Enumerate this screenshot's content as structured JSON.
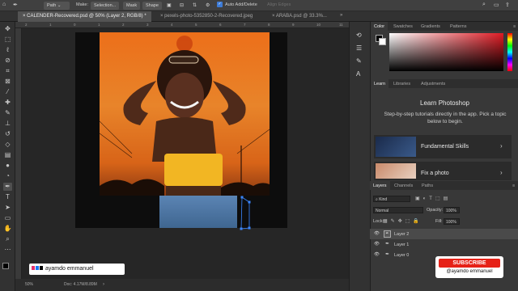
{
  "options_bar": {
    "mode_value": "Path",
    "make_label": "Make:",
    "selection_button": "Selection...",
    "mask_button": "Mask",
    "shape_button": "Shape",
    "auto_add_delete_label": "Auto Add/Delete",
    "align_edges_label": "Align Edges"
  },
  "tabs": [
    {
      "label": "CALENDER-Recovered.psd @ 50% (Layer 2, RGB/8) *",
      "active": true
    },
    {
      "label": "pexels-photo-5352850-2-Recovered.jpeg",
      "active": false
    },
    {
      "label": "ARABA.psd @ 33.3%...",
      "active": false
    }
  ],
  "ruler": {
    "ticks": [
      "2",
      "1",
      "0",
      "1",
      "2",
      "3",
      "4",
      "5",
      "6",
      "7",
      "8",
      "9",
      "10",
      "11"
    ]
  },
  "status": {
    "zoom": "50%",
    "doc": "Doc: 4.17M/8.89M"
  },
  "color_panel": {
    "tabs": [
      "Color",
      "Swatches",
      "Gradients",
      "Patterns"
    ],
    "foreground_color": "#000000",
    "background_color": "#ffffff",
    "hue_color": "#e01b24"
  },
  "learn_panel": {
    "tabs": [
      "Learn",
      "Libraries",
      "Adjustments"
    ],
    "title": "Learn Photoshop",
    "description": "Step-by-step tutorials directly in the app. Pick a topic below to begin.",
    "tutorials": [
      {
        "label": "Fundamental Skills"
      },
      {
        "label": "Fix a photo"
      }
    ]
  },
  "layers_panel": {
    "tabs": [
      "Layers",
      "Channels",
      "Paths"
    ],
    "kind_filter": "Kind",
    "blend_mode": "Normal",
    "opacity_label": "Opacity:",
    "opacity_value": "100%",
    "lock_label": "Lock:",
    "fill_label": "Fill:",
    "fill_value": "100%",
    "layers": [
      {
        "name": "Layer 2",
        "selected": true
      },
      {
        "name": "Layer 1",
        "selected": false
      },
      {
        "name": "Layer 0",
        "selected": false
      }
    ]
  },
  "watermark": {
    "name": "ayamdo emmanuel"
  },
  "subscribe": {
    "label": "SUBSCRIBE",
    "handle": "@ayamdo emmanuel",
    "color": "#e62117"
  }
}
